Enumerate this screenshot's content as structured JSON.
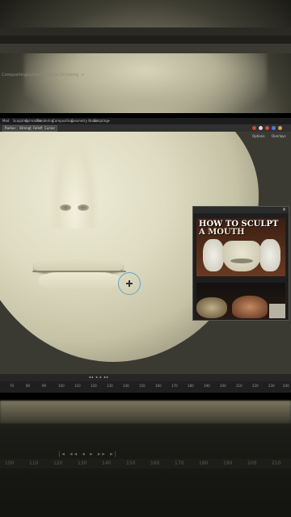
{
  "top_blur": {
    "tabs": [
      "Compositing",
      "Geometry Nodes",
      "Scripting",
      "+"
    ]
  },
  "menubar": {
    "items": [
      "Mod",
      "Sculpting",
      "Animation",
      "Rendering",
      "Compositing",
      "Geometry Nodes",
      "Scripting",
      "+"
    ]
  },
  "header": {
    "buttons": [
      "Radius",
      "Strength",
      "Falloff",
      "Cursor"
    ]
  },
  "viewport_overlay": {
    "labels": [
      "Options",
      "Overlays"
    ]
  },
  "popup": {
    "close_glyph": "×",
    "thumb1_title_line1": "HOW TO SCULPT",
    "thumb1_title_line2": "A MOUTH"
  },
  "timeline": {
    "controls": "◂◂ ◂ ▸ ▸▸",
    "ruler": [
      "70",
      "80",
      "90",
      "100",
      "110",
      "120",
      "130",
      "140",
      "150",
      "160",
      "170",
      "180",
      "190",
      "200",
      "210",
      "220",
      "230",
      "240"
    ]
  },
  "bottom_blur": {
    "controls": "|◂ ◂◂ ◂ ▸ ▸▸ ▸|",
    "ruler": [
      "100",
      "110",
      "120",
      "130",
      "140",
      "150",
      "160",
      "170",
      "180",
      "190",
      "200",
      "210"
    ]
  },
  "colors": {
    "clay": "#dedbc2",
    "brush_cursor": "#5fa9c9",
    "ui_dark": "#2b2b2b"
  }
}
